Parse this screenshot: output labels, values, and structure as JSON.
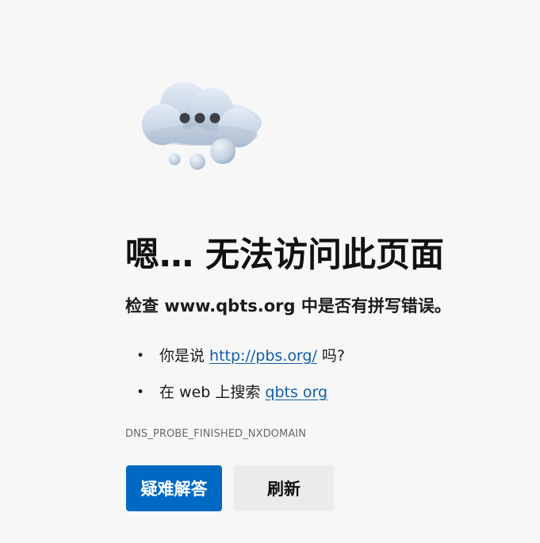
{
  "illustration": {
    "icon": "cloud-thinking-icon"
  },
  "error": {
    "title": "嗯… 无法访问此页面",
    "subtitle": "检查 www.qbts.org 中是否有拼写错误。",
    "code": "DNS_PROBE_FINISHED_NXDOMAIN"
  },
  "suggestions": [
    {
      "prefix": "你是说 ",
      "link_text": "http://pbs.org/",
      "suffix": " 吗?"
    },
    {
      "prefix": "在 web 上搜索 ",
      "link_text": "qbts org",
      "suffix": ""
    }
  ],
  "buttons": {
    "troubleshoot_label": "疑难解答",
    "refresh_label": "刷新"
  },
  "colors": {
    "background": "#f7f7f7",
    "primary_button": "#0069c4",
    "secondary_button": "#ebebeb",
    "link": "#0f5ea8"
  }
}
